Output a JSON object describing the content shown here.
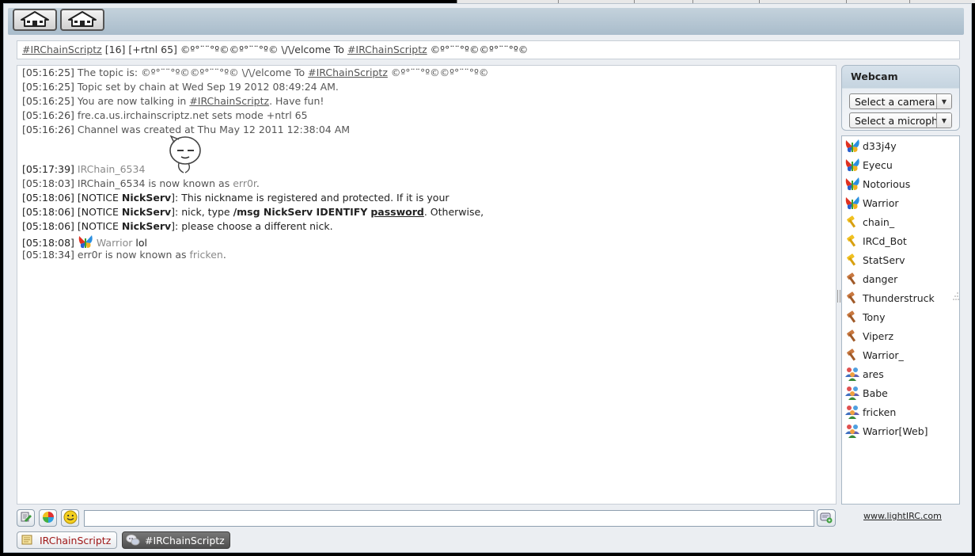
{
  "window": {
    "app": "lightIRC"
  },
  "toolbar": {
    "buttons": [
      {
        "icon": "home-icon"
      },
      {
        "icon": "home-icon"
      }
    ]
  },
  "topic_bar": {
    "channel": "#IRChainScriptz",
    "info": "[16] [+rtnl 65] ©º°¨¨°º©©º°¨¨°º© \\/\\/elcome To",
    "channel2": "#IRChainScriptz",
    "tail": "©º°¨¨°º©©º°¨¨°º©"
  },
  "chat": {
    "l1": {
      "ts": "[05:16:25]",
      "pre": "The topic is: ©º°¨¨°º©©º°¨¨°º© \\/\\/elcome To",
      "link": "#IRChainScriptz",
      "post": "©º°¨¨°º©©º°¨¨°º©"
    },
    "l2": {
      "ts": "[05:16:25]",
      "text": "Topic set by chain at Wed Sep 19 2012 08:49:24 AM."
    },
    "l3": {
      "ts": "[05:16:25]",
      "pre": "You are now talking in",
      "link": "#IRChainScriptz",
      "post": ". Have fun!"
    },
    "l4": {
      "ts": "[05:16:26]",
      "text": "fre.ca.us.irchainscriptz.net sets mode +ntrl 65"
    },
    "l5": {
      "ts": "[05:16:26]",
      "text": "Channel was created at Thu May 12 2011 12:38:04 AM"
    },
    "l6": {
      "ts": "[05:17:39]",
      "nick": "IRChain_6534"
    },
    "l7": {
      "ts": "[05:18:03]",
      "pre": "IRChain_6534 is now known as",
      "nick": "err0r",
      "post": "."
    },
    "l8": {
      "ts": "[05:18:06]",
      "pre": "[NOTICE",
      "nick": "NickServ",
      "text": "]: This nickname is registered and protected.  If it is your"
    },
    "l9": {
      "ts": "[05:18:06]",
      "pre": "[NOTICE",
      "nick": "NickServ",
      "mid": "]: nick, type",
      "cmd": "/msg NickServ IDENTIFY",
      "pw": "password",
      "post": ".  Otherwise,"
    },
    "l10": {
      "ts": "[05:18:06]",
      "pre": "[NOTICE",
      "nick": "NickServ",
      "text": "]: please choose a different nick."
    },
    "l11": {
      "ts": "[05:18:08]",
      "nick": "Warrior",
      "text": "lol"
    },
    "l12": {
      "ts": "[05:18:34]",
      "pre": "err0r is now known as",
      "nick": "fricken",
      "post": "."
    }
  },
  "webcam": {
    "title": "Webcam",
    "camera": "Select a camera",
    "microphone": "Select a microphone"
  },
  "users": [
    {
      "name": "d33j4y",
      "icon": "butterfly-icon"
    },
    {
      "name": "Eyecu",
      "icon": "butterfly-icon"
    },
    {
      "name": "Notorious",
      "icon": "butterfly-icon"
    },
    {
      "name": "Warrior",
      "icon": "butterfly-icon"
    },
    {
      "name": "chain_",
      "icon": "gold-hammer-icon"
    },
    {
      "name": "IRCd_Bot",
      "icon": "gold-hammer-icon"
    },
    {
      "name": "StatServ",
      "icon": "gold-hammer-icon"
    },
    {
      "name": "danger",
      "icon": "brown-hammer-icon"
    },
    {
      "name": "Thunderstruck",
      "icon": "brown-hammer-icon"
    },
    {
      "name": "Tony",
      "icon": "brown-hammer-icon"
    },
    {
      "name": "Viperz",
      "icon": "brown-hammer-icon"
    },
    {
      "name": "Warrior_",
      "icon": "brown-hammer-icon"
    },
    {
      "name": "ares",
      "icon": "users-icon"
    },
    {
      "name": "Babe",
      "icon": "users-icon"
    },
    {
      "name": "fricken",
      "icon": "users-icon"
    },
    {
      "name": "Warrior[Web]",
      "icon": "users-icon"
    }
  ],
  "input": {
    "value": "",
    "placeholder": ""
  },
  "credit": "www.lightIRC.com",
  "tabs": [
    {
      "label": "IRChainScriptz",
      "icon": "note-icon",
      "active": false
    },
    {
      "label": "#IRChainScriptz",
      "icon": "chat-bubbles-icon",
      "active": true
    }
  ],
  "colors": {
    "frame": "#ebeef2",
    "toolbar": "#b3c4d2",
    "nick_dim": "#8a8a8a",
    "tab1_text": "#a01818",
    "tab2_bg": "#5a5a5a"
  }
}
